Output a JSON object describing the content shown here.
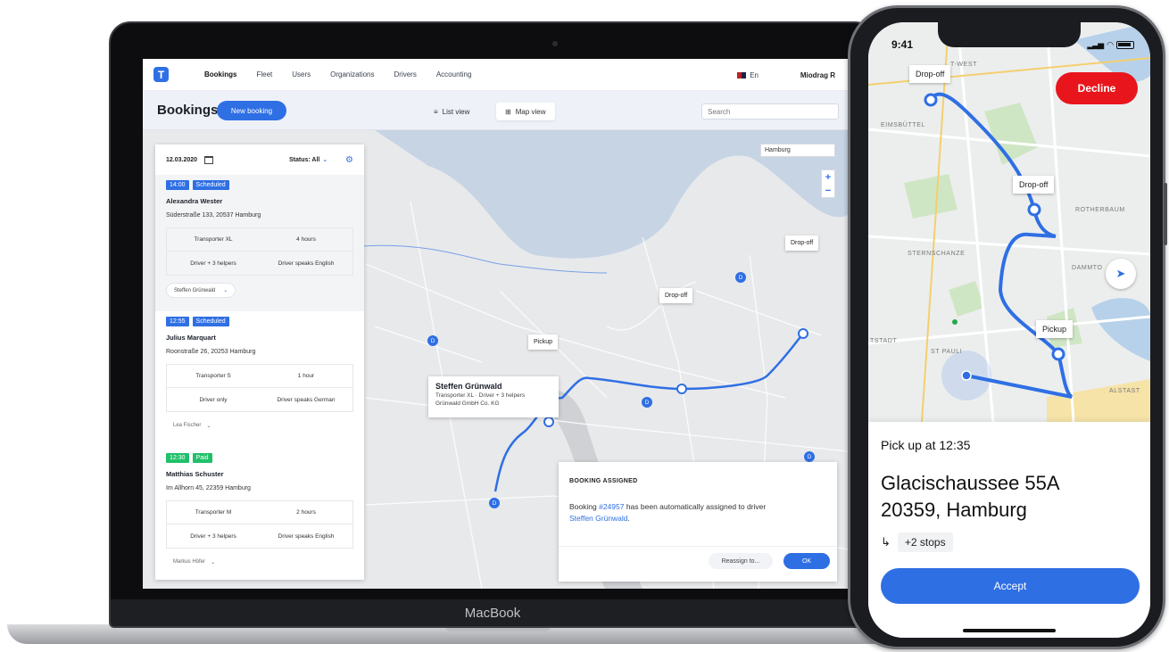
{
  "laptop": {
    "brand": "MacBook",
    "nav": {
      "logo": "T",
      "links": [
        "Bookings",
        "Fleet",
        "Users",
        "Organizations",
        "Drivers",
        "Accounting"
      ],
      "language": "En",
      "user": "Miodrag R"
    },
    "toolbar": {
      "title": "Bookings",
      "new_booking": "New booking",
      "list_view": "List view",
      "map_view": "Map view",
      "search_placeholder": "Search"
    },
    "map": {
      "city_select": "Hamburg",
      "zoom_in": "+",
      "zoom_out": "−",
      "labels": {
        "dropoff_1": "Drop-off",
        "dropoff_2": "Drop-off",
        "pickup": "Pickup"
      },
      "driver_popup": {
        "name": "Steffen Grünwald",
        "line1": "Transporter XL · Driver + 3 helpers",
        "line2": "Grünwald GmbH Co. KG"
      },
      "driver_marker": "D"
    },
    "bookings_panel": {
      "date": "12.03.2020",
      "status": "Status: All",
      "items": [
        {
          "time": "14:00",
          "status": "Scheduled",
          "status_color": "#2f6fe4",
          "customer": "Alexandra Wester",
          "address": "Süderstraße 133, 20537 Hamburg",
          "vehicle": "Transporter XL",
          "duration": "4 hours",
          "crew": "Driver + 3 helpers",
          "language": "Driver speaks English",
          "driver": "Steffen Grünwald"
        },
        {
          "time": "12:55",
          "status": "Scheduled",
          "status_color": "#2f6fe4",
          "customer": "Julius Marquart",
          "address": "Roonstraße 26, 20253 Hamburg",
          "vehicle": "Transporter S",
          "duration": "1 hour",
          "crew": "Driver only",
          "language": "Driver speaks German",
          "driver": "Lea Fischer"
        },
        {
          "time": "12:30",
          "status": "Paid",
          "status_color": "#20c06a",
          "customer": "Matthias Schuster",
          "address": "Im Allhorn 45, 22359 Hamburg",
          "vehicle": "Transporter M",
          "duration": "2 hours",
          "crew": "Driver + 3 helpers",
          "language": "Driver speaks English",
          "driver": "Markus Höfer"
        }
      ]
    },
    "notification": {
      "title": "BOOKING ASSIGNED",
      "text_before": "Booking ",
      "booking_id": "#24957",
      "text_middle": " has been automatically assigned to driver",
      "driver": "Steffen Grünwald",
      "text_after": ".",
      "reassign": "Reassign to...",
      "ok": "OK"
    }
  },
  "phone": {
    "time": "9:41",
    "decline": "Decline",
    "map_labels": {
      "dropoff_top": "Drop-off",
      "dropoff_mid": "Drop-off",
      "pickup": "Pickup"
    },
    "streets": [
      "T-WEST",
      "EIMSBÜTTEL",
      "ROTHERBAUM",
      "STERNSCHANZE",
      "DAMMTO",
      "TSTADT",
      "ST PAULI",
      "ALSTAST"
    ],
    "pickup_time": "Pick up at 12:35",
    "address_line1": "Glacischaussee 55A",
    "address_line2": "20359, Hamburg",
    "stops": "+2 stops",
    "accept": "Accept"
  },
  "colors": {
    "accent": "#2f6fe4",
    "decline": "#e8161c",
    "paid": "#20c06a"
  }
}
